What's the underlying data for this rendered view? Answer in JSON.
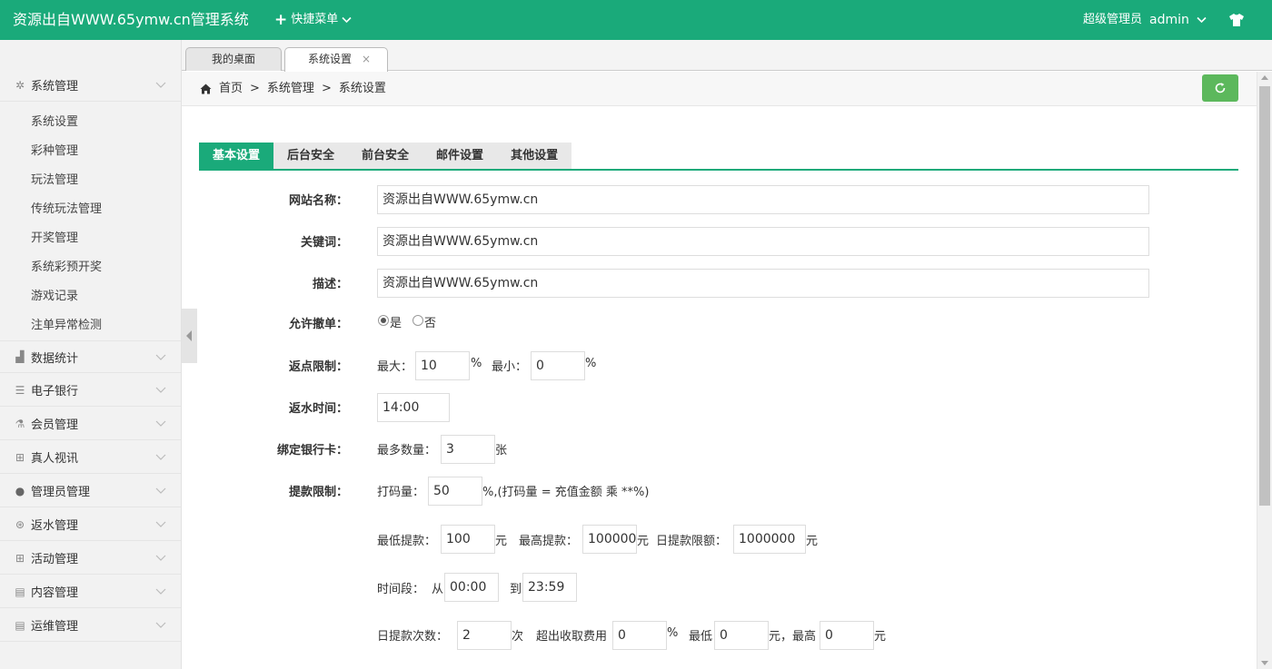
{
  "topbar": {
    "title": "资源出自WWW.65ymw.cn管理系统",
    "quick_menu": "快捷菜单",
    "role": "超级管理员",
    "user": "admin"
  },
  "sidebar": {
    "groups": [
      {
        "label": "系统管理",
        "icon": "gear-icon",
        "items": [
          "系统设置",
          "彩种管理",
          "玩法管理",
          "传统玩法管理",
          "开奖管理",
          "系统彩预开奖",
          "游戏记录",
          "注单异常检测"
        ]
      },
      {
        "label": "数据统计",
        "icon": "bar-chart-icon"
      },
      {
        "label": "电子银行",
        "icon": "list-icon"
      },
      {
        "label": "会员管理",
        "icon": "flask-icon"
      },
      {
        "label": "真人视讯",
        "icon": "gift-icon"
      },
      {
        "label": "管理员管理",
        "icon": "user-icon"
      },
      {
        "label": "返水管理",
        "icon": "coin-icon"
      },
      {
        "label": "活动管理",
        "icon": "gift-icon"
      },
      {
        "label": "内容管理",
        "icon": "document-icon"
      },
      {
        "label": "运维管理",
        "icon": "document-icon"
      }
    ]
  },
  "page_tabs": [
    {
      "label": "我的桌面"
    },
    {
      "label": "系统设置",
      "close": "×"
    }
  ],
  "breadcrumb": {
    "home": "首页",
    "sep": ">",
    "level1": "系统管理",
    "level2": "系统设置"
  },
  "settings_tabs": [
    "基本设置",
    "后台安全",
    "前台安全",
    "邮件设置",
    "其他设置"
  ],
  "form": {
    "site_name_label": "网站名称：",
    "site_name_value": "资源出自WWW.65ymw.cn",
    "keywords_label": "关键词：",
    "keywords_value": "资源出自WWW.65ymw.cn",
    "desc_label": "描述：",
    "desc_value": "资源出自WWW.65ymw.cn",
    "cancel_label": "允许撤单：",
    "cancel_yes": "是",
    "cancel_no": "否",
    "rebate_label": "返点限制：",
    "rebate_max_label": "最大：",
    "rebate_max_value": "10",
    "rebate_min_label": "最小：",
    "rebate_min_value": "0",
    "percent": "%",
    "refund_time_label": "返水时间：",
    "refund_time_value": "14:00",
    "bankcard_label": "绑定银行卡：",
    "bankcard_max_label": "最多数量：",
    "bankcard_max_value": "3",
    "bankcard_unit": "张",
    "withdraw_label": "提款限制：",
    "bet_label": "打码量：",
    "bet_value": "50",
    "bet_note": "%,(打码量 = 充值金额 乘 **%)",
    "min_withdraw_label": "最低提款：",
    "min_withdraw_value": "100",
    "yuan": "元",
    "max_withdraw_label": "最高提款：",
    "max_withdraw_value": "100000",
    "daily_limit_label": "日提款限额：",
    "daily_limit_value": "1000000",
    "period_label": "时间段：",
    "from_label": "从",
    "from_value": "00:00",
    "to_label": "到",
    "to_value": "23:59",
    "daily_count_label": "日提款次数：",
    "daily_count_value": "2",
    "times_unit": "次",
    "exceed_fee_label": "超出收取费用",
    "exceed_fee_value": "0",
    "min_fee_label": "最低",
    "min_fee_value": "0",
    "max_fee_label": "元，最高",
    "max_fee_value": "0"
  },
  "colors": {
    "brand": "#1aaa7a",
    "refresh": "#5cb85c"
  }
}
